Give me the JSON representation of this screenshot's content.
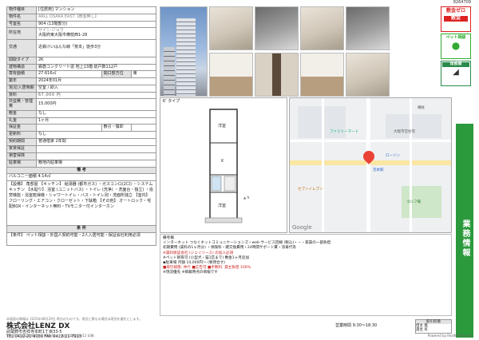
{
  "doc_id": "8264709",
  "fields": {
    "type_label": "物件種目",
    "type_value": "[住居用] マンション",
    "name_label": "物件名",
    "name_value": "ARLL OSAKA EAST【敷金無し】",
    "room_label": "号室名",
    "room_value": "904 (13階部分)",
    "address_label": "所在地",
    "address_kana": "サイシ-ジョウ",
    "address_value": "大阪府東大阪市横枕西1-28",
    "access_label": "交通",
    "access_value": "近鉄けいはんな線「荒本」徒歩3分",
    "layout_label": "間取タイプ",
    "layout_value": "2K",
    "structure_label": "建物構造",
    "structure_value": "鉄筋コンクリート造 地上13階 総戸数112戸",
    "area_label": "専有面積",
    "area_value": "27.616㎡",
    "direction_label": "間口部方位",
    "direction_value": "東",
    "built_label": "築年",
    "built_value": "2024年01月",
    "current_label": "現況/入居時期",
    "current_value": "空室 / 即入",
    "rent_label": "賃料",
    "rent_value": "67,000 円",
    "fee_label": "共益費・管理費",
    "fee_value": "15,000円",
    "deposit_label": "敷金",
    "deposit_value": "なし",
    "key_label": "礼金",
    "key_value": "1ヶ月",
    "guarantee_label": "保証金",
    "guarantee_value": "",
    "shoukyaku_label": "敷引・償却",
    "shoukyaku_value": "",
    "renewal_label": "更新料",
    "renewal_value": "なし",
    "contract_label": "契約期間",
    "contract_value": "普通借家 2年間",
    "rent_guarantee_label": "家賃保証",
    "rent_guarantee_value": "",
    "insurance_label": "損害保険",
    "insurance_value": "",
    "parking_label": "駐車場",
    "parking_value": "敷地内駐車場"
  },
  "section_notes": "備 考",
  "balcony": "バルコニー面積 4.14㎡",
  "equipment_text": "【設備】 角部屋 【キッチン】 給湯器 (都市ガス) ・ガスコンロ(2口) ・システムキッチン 【水廻り】 浴室 (ユニットバス) ・トイレ (洗浄) ・洗面台・独立) ・追焚機能・浴室乾燥機・シャワートイレ・バス・トイレ別・洗面所独立 【室内】 フローリング・エアコン・クローゼット・下駄箱 【その他】 オートロック・宅配BOX・インターネット無料・TVモニター付インターホン",
  "section_terms": "条 件",
  "terms_text": "【条件】 ペット相談・外国人契約可能・2人入居可能・保証会社利用必須",
  "photos_alt": [
    "外観",
    "キッチン",
    "浴室",
    "洗面",
    "室内",
    "トイレ",
    "玄関",
    "廊下",
    "収納"
  ],
  "badges": {
    "b1_title": "敷金ゼロ",
    "b1_mark": "敷金",
    "b2_title": "ペット相談",
    "b3_title": "角部屋"
  },
  "sidebar_label": "業務情報",
  "floorplan": {
    "label": "K' タイプ",
    "rooms": [
      "洋室",
      "K",
      "洋室"
    ]
  },
  "map": {
    "pois": [
      "ファミリーマート",
      "荒本駅",
      "ローソン",
      "セブンイレブン",
      "大阪市営住宅",
      "ゴルフ場",
      "横枕"
    ],
    "provider": "Google"
  },
  "notes": [
    "備考欄",
    "インターネット つなぐネットコミュニケーションズ・web サービス回線 (税込)・・・家賃の一部負担",
    "初期費用 (賃料の1ヶ月分) ・保険料・鍵交換費用・24時間サポート費・消毒代等",
    "※賃料保証会社 (ジェイリース) の加入必須",
    "※ペット飼育可 (小型犬・猫1匹まで) 敷金1ヶ月追加",
    "◆駐車場 月額 10,000円〜 (要問合せ)",
    "■取引様態: 仲介 ■広告可 ■手数料: 貸主負担 100%",
    "※現況優先 ※掲載時点の情報です"
  ],
  "footer_line": "本図面の情報は 2025年08月29日 時点のものです。現況と異なる場合は現況を優先とします。",
  "company": {
    "name": "株式会社LENZ DX",
    "address": "武蔵野市吉祥寺本町1丁目33-5",
    "tel": "TEL 0422-21-9100 FAX 0422-21-7913",
    "hours": "営業時間 9:30〜18:30"
  },
  "commission": {
    "title": "取引形態",
    "rows": [
      "借主 無",
      "貸主 有"
    ]
  },
  "print": {
    "left": "15:26:20 2025/08/29 17:48:40 ・ 発行 2025/10/12 印刷",
    "right": "Powered by RealNetPro.com"
  }
}
